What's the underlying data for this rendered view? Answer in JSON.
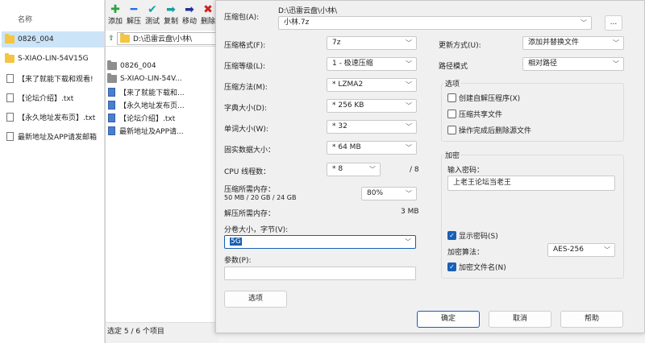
{
  "explorer": {
    "column_name": "名称",
    "items": [
      {
        "name": "0826_004",
        "type": "folder",
        "selected": true
      },
      {
        "name": "S-XIAO-LIN-54V15G",
        "type": "folder",
        "selected": false
      },
      {
        "name": "【来了就能下载和观看!",
        "type": "doc",
        "selected": false
      },
      {
        "name": "【论坛介绍】.txt",
        "type": "doc",
        "selected": false
      },
      {
        "name": "【永久地址发布页】.txt",
        "type": "doc",
        "selected": false
      },
      {
        "name": "最新地址及APP请发邮箱",
        "type": "doc",
        "selected": false
      }
    ]
  },
  "manager": {
    "toolbar": [
      {
        "label": "添加",
        "icon": "plus-icon",
        "glyph": "✚",
        "color": "#2ea043"
      },
      {
        "label": "解压",
        "icon": "minus-icon",
        "glyph": "━",
        "color": "#1f6feb"
      },
      {
        "label": "测试",
        "icon": "check-icon",
        "glyph": "✔",
        "color": "#18a0a0"
      },
      {
        "label": "复制",
        "icon": "copy-arrow-icon",
        "glyph": "➡",
        "color": "#18a0a0"
      },
      {
        "label": "移动",
        "icon": "move-arrow-icon",
        "glyph": "➡",
        "color": "#23319a"
      },
      {
        "label": "删除",
        "icon": "delete-x-icon",
        "glyph": "✖",
        "color": "#d02020"
      }
    ],
    "address": "D:\\迅雷云盘\\小林\\",
    "items": [
      {
        "name": "0826_004",
        "type": "folder"
      },
      {
        "name": "S-XIAO-LIN-54V...",
        "type": "folder"
      },
      {
        "name": "【来了就能下载和...",
        "type": "doc"
      },
      {
        "name": "【永久地址发布页...",
        "type": "doc"
      },
      {
        "name": "【论坛介绍】.txt",
        "type": "doc"
      },
      {
        "name": "最新地址及APP请...",
        "type": "doc"
      }
    ],
    "status": "选定 5 / 6 个项目"
  },
  "dialog": {
    "archive_label": "压缩包(A):",
    "archive_dir": "D:\\迅雷云盘\\小林\\",
    "archive_name": "小林.7z",
    "browse_label": "...",
    "format_label": "压缩格式(F):",
    "format_value": "7z",
    "level_label": "压缩等级(L):",
    "level_value": "1 - 极速压缩",
    "method_label": "压缩方法(M):",
    "method_value": "* LZMA2",
    "dict_label": "字典大小(D):",
    "dict_value": "* 256 KB",
    "word_label": "单词大小(W):",
    "word_value": "* 32",
    "solid_label": "固实数据大小：",
    "solid_value": "* 64 MB",
    "cpu_label": "CPU 线程数：",
    "cpu_value": "* 8",
    "cpu_total": "/ 8",
    "mem_label": "压缩所需内存：",
    "mem_detail": "50 MB / 20 GB / 24 GB",
    "mem_value": "80%",
    "decomp_label": "解压所需内存：",
    "decomp_value": "3 MB",
    "volume_label": "分卷大小，字节(V):",
    "volume_value": "5G",
    "params_label": "参数(P):",
    "params_value": "",
    "options_button": "选项",
    "update_label": "更新方式(U):",
    "update_value": "添加并替换文件",
    "path_label": "路径模式",
    "path_value": "相对路径",
    "options_group": "选项",
    "opt_sfx": "创建自解压程序(X)",
    "opt_shared": "压缩共享文件",
    "opt_delete": "操作完成后删除源文件",
    "encrypt_group": "加密",
    "password_label": "输入密码：",
    "password_value": "上老王论坛当老王",
    "show_password": "显示密码(S)",
    "algo_label": "加密算法：",
    "algo_value": "AES-256",
    "encrypt_names": "加密文件名(N)",
    "ok": "确定",
    "cancel": "取消",
    "help": "帮助"
  },
  "colors": {
    "accent": "#1a5fb4",
    "selection": "#cce4f7"
  }
}
